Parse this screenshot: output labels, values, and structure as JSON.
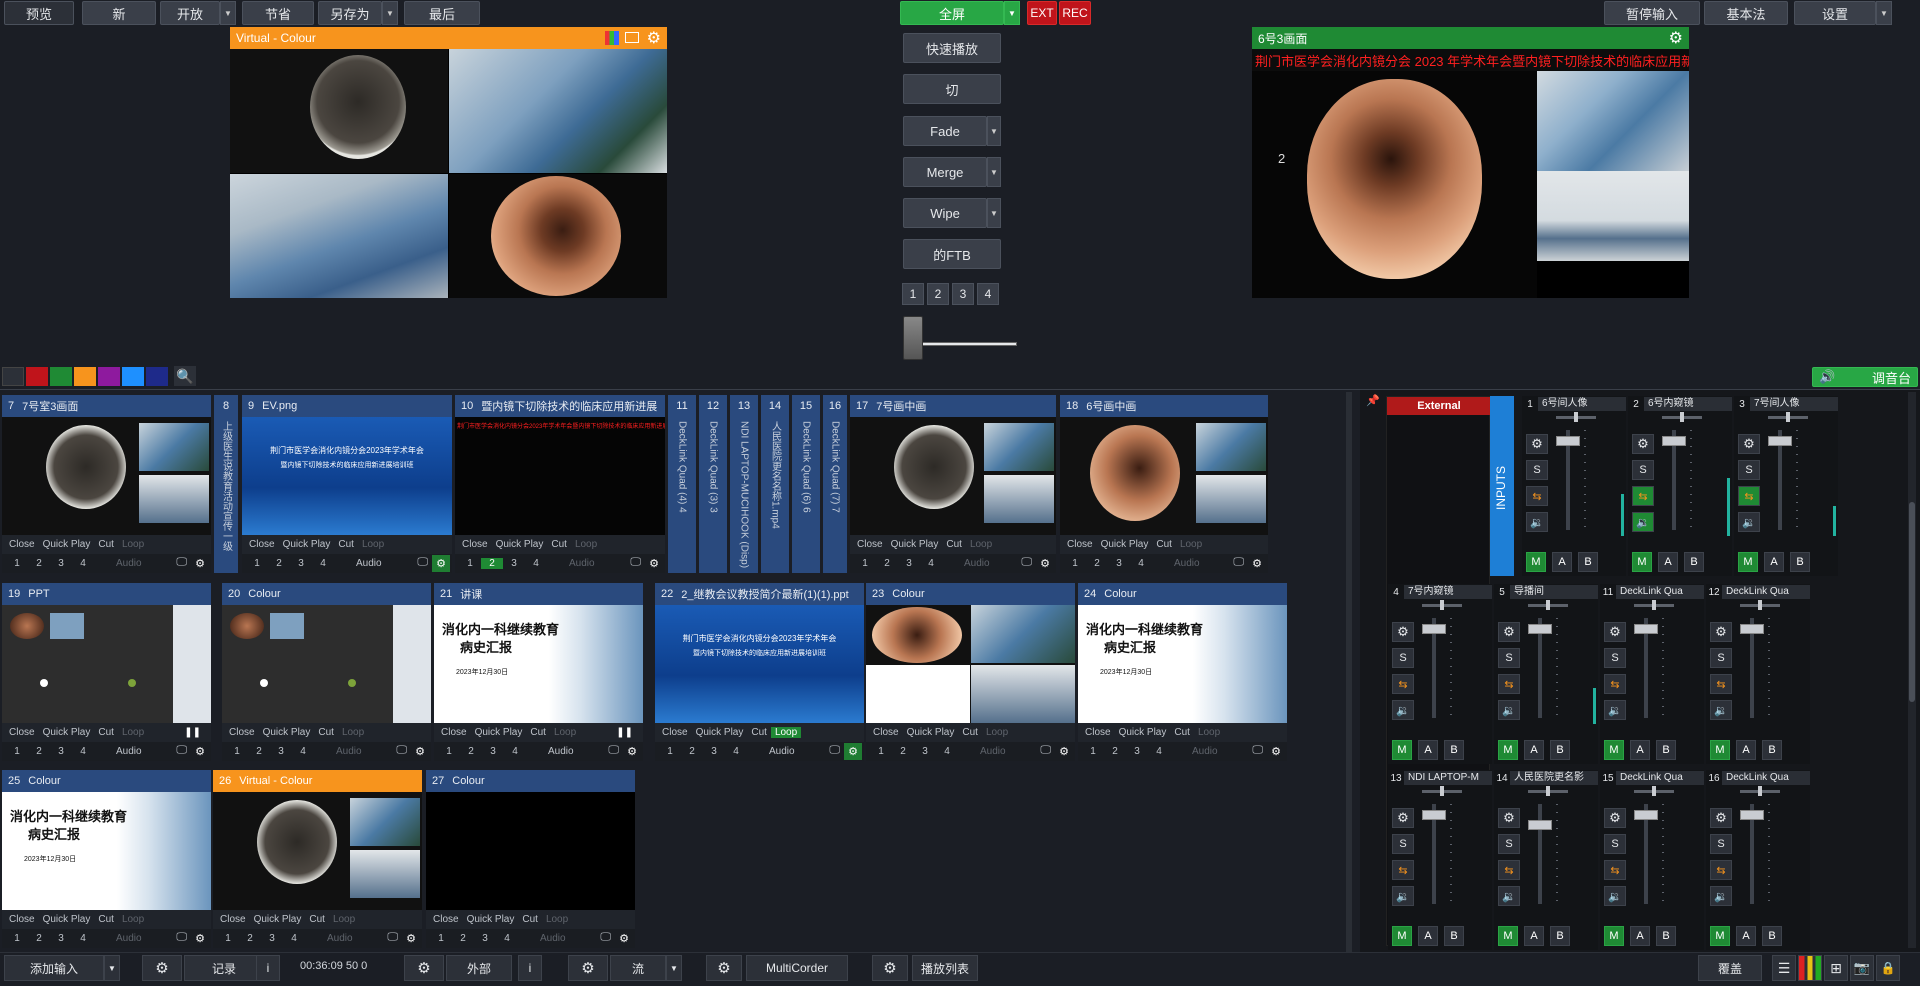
{
  "topbar": {
    "preview_label": "预览",
    "new_label": "新",
    "open_label": "开放",
    "save_label": "节省",
    "save_as_label": "另存为",
    "last_label": "最后",
    "fullscreen_label": "全屏",
    "ext_label": "EXT",
    "rec_label": "REC",
    "pause_input_label": "暂停输入",
    "basic_label": "基本法",
    "settings_label": "设置"
  },
  "preview": {
    "title": "Virtual - Colour"
  },
  "transitions": {
    "quick_play": "快速播放",
    "cut": "切",
    "fade": "Fade",
    "merge": "Merge",
    "wipe": "Wipe",
    "ftb": "的FTB",
    "numbers": [
      "1",
      "2",
      "3",
      "4"
    ],
    "active_number": "2"
  },
  "output": {
    "title": "6号3画面",
    "banner": "荆门市医学会消化内镜分会 2023 年学术年会暨内镜下切除技术的临床应用新进展",
    "overlay_number": "2"
  },
  "colors": {
    "swatches": [
      "#1b1e25",
      "#c0141b",
      "#1f8a34",
      "#f7941d",
      "#8e1a9e",
      "#1e90ff",
      "#1e2a8a"
    ],
    "accent_green": "#28a745",
    "tile_blue": "#2a4a7e",
    "active_orange": "#f7941d",
    "rec_red": "#c0141b"
  },
  "audio_toggle_label": "调音台",
  "tile_controls": {
    "close": "Close",
    "quick_play": "Quick Play",
    "cut": "Cut",
    "loop": "Loop",
    "audio": "Audio",
    "nums": [
      "1",
      "2",
      "3",
      "4"
    ]
  },
  "tiles": [
    {
      "num": "7",
      "name": "7号室3画面"
    },
    {
      "num": "8",
      "name": "上级医生说教育活动宣传一级"
    },
    {
      "num": "9",
      "name": "EV.png"
    },
    {
      "num": "10",
      "name": "暨内镜下切除技术的临床应用新进展"
    },
    {
      "num": "11",
      "name": "DeckLink Quad (4) 4"
    },
    {
      "num": "12",
      "name": "DeckLink Quad (3) 3"
    },
    {
      "num": "13",
      "name": "NDI LAPTOP-MUCIHOOK (Disp)"
    },
    {
      "num": "14",
      "name": "人民医院更名名称1.mp4"
    },
    {
      "num": "15",
      "name": "DeckLink Quad (6) 6"
    },
    {
      "num": "16",
      "name": "DeckLink Quad (7) 7"
    },
    {
      "num": "17",
      "name": "7号画中画"
    },
    {
      "num": "18",
      "name": "6号画中画"
    },
    {
      "num": "19",
      "name": "PPT"
    },
    {
      "num": "20",
      "name": "Colour"
    },
    {
      "num": "21",
      "name": "讲课"
    },
    {
      "num": "22",
      "name": "2_继教会议教授简介最新(1)(1).ppt"
    },
    {
      "num": "23",
      "name": "Colour"
    },
    {
      "num": "24",
      "name": "Colour"
    },
    {
      "num": "25",
      "name": "Colour"
    },
    {
      "num": "26",
      "name": "Virtual - Colour"
    },
    {
      "num": "27",
      "name": "Colour"
    }
  ],
  "slides": {
    "event_title": "荆门市医学会消化内镜分会2023年学术年会",
    "event_subtitle": "暨内镜下切除技术的临床应用新进展培训班",
    "report_title_1": "消化内一科继续教育",
    "report_title_2": "病史汇报",
    "report_date": "2023年12月30日",
    "tile10_banner": "荆门市医学会消化内镜分会2023年学术年会暨内镜下切除技术的临床应用新进展"
  },
  "mixer": {
    "external_label": "External",
    "inputs_label": "INPUTS",
    "s": "S",
    "m": "M",
    "a": "A",
    "b": "B",
    "channels": [
      {
        "num": "1",
        "name": "6号间人像"
      },
      {
        "num": "2",
        "name": "6号内窥镜"
      },
      {
        "num": "3",
        "name": "7号间人像"
      },
      {
        "num": "4",
        "name": "7号内窥镜"
      },
      {
        "num": "5",
        "name": "导播间"
      },
      {
        "num": "11",
        "name": "DeckLink Qua"
      },
      {
        "num": "12",
        "name": "DeckLink Qua"
      },
      {
        "num": "13",
        "name": "NDI LAPTOP-M"
      },
      {
        "num": "14",
        "name": "人民医院更名影"
      },
      {
        "num": "15",
        "name": "DeckLink Qua"
      },
      {
        "num": "16",
        "name": "DeckLink Qua"
      }
    ]
  },
  "bottombar": {
    "add_input": "添加输入",
    "record": "记录",
    "info": "i",
    "timecode": "00:36:09 50 0",
    "external": "外部",
    "stream": "流",
    "multicorder": "MultiCorder",
    "playlist": "播放列表",
    "overlay": "覆盖"
  }
}
